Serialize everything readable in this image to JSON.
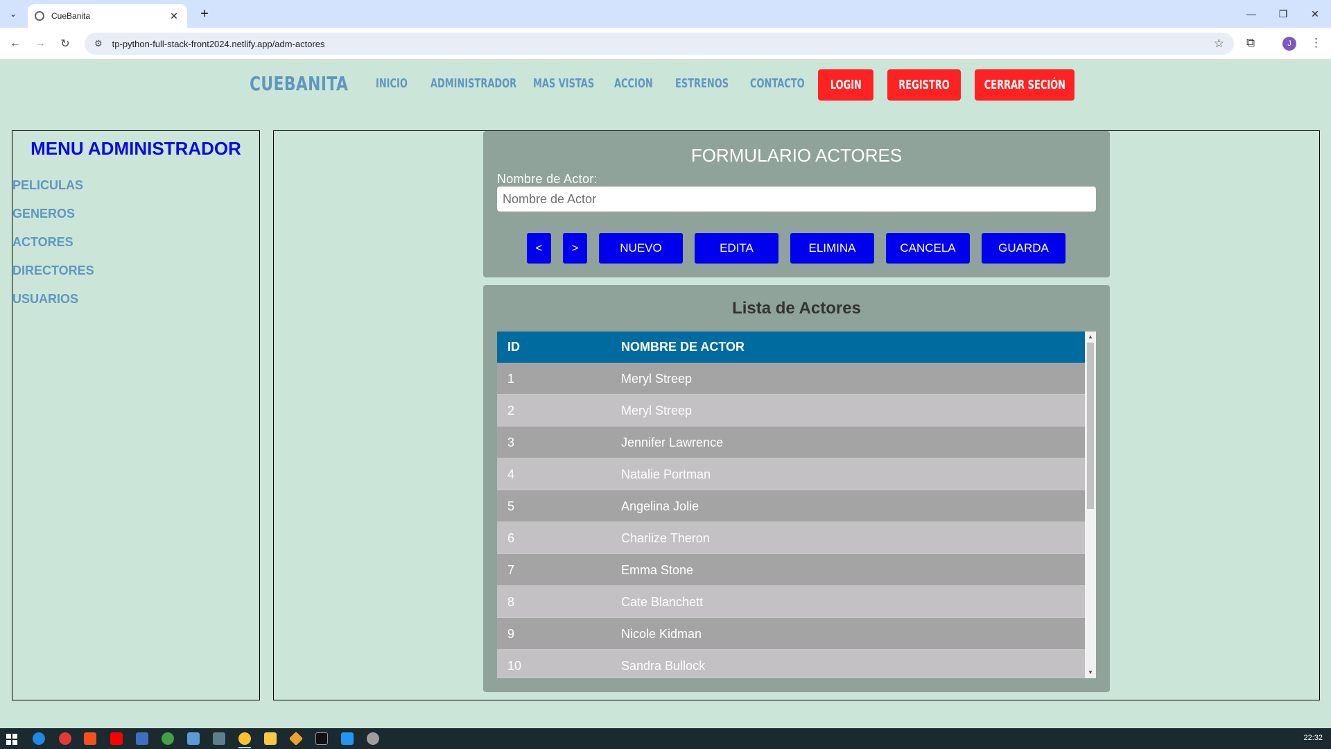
{
  "browser": {
    "tab_title": "CueBanita",
    "new_tab": "+",
    "close_tab": "✕",
    "url": "tp-python-full-stack-front2024.netlify.app/adm-actores",
    "profile_initial": "J"
  },
  "header": {
    "logo": "CUEBANITA",
    "nav": [
      "INICIO",
      "ADMINISTRADOR",
      "MAS VISTAS",
      "ACCION",
      "ESTRENOS",
      "CONTACTO"
    ],
    "login": "LOGIN",
    "registro": "REGISTRO",
    "cerrar": "CERRAR SECIÓN",
    "accent_color": "#ff2222",
    "link_color": "#5f97c0"
  },
  "sidebar": {
    "title": "MENU ADMINISTRADOR",
    "items": [
      "PELICULAS",
      "GENEROS",
      "ACTORES",
      "DIRECTORES",
      "USUARIOS"
    ]
  },
  "form": {
    "title": "FORMULARIO ACTORES",
    "label": "Nombre de Actor:",
    "input_value": "",
    "input_placeholder": "Nombre de Actor",
    "buttons": {
      "prev": "<",
      "next": ">",
      "nuevo": "NUEVO",
      "edita": "EDITA",
      "elimina": "ELIMINA",
      "cancela": "CANCELA",
      "guarda": "GUARDA"
    }
  },
  "list": {
    "title": "Lista de Actores",
    "columns": [
      "ID",
      "NOMBRE DE ACTOR"
    ],
    "rows": [
      {
        "id": "1",
        "name": "Meryl Streep"
      },
      {
        "id": "2",
        "name": "Meryl Streep"
      },
      {
        "id": "3",
        "name": "Jennifer Lawrence"
      },
      {
        "id": "4",
        "name": "Natalie Portman"
      },
      {
        "id": "5",
        "name": "Angelina Jolie"
      },
      {
        "id": "6",
        "name": "Charlize Theron"
      },
      {
        "id": "7",
        "name": "Emma Stone"
      },
      {
        "id": "8",
        "name": "Cate Blanchett"
      },
      {
        "id": "9",
        "name": "Nicole Kidman"
      },
      {
        "id": "10",
        "name": "Sandra Bullock"
      }
    ]
  },
  "taskbar": {
    "clock": "22:32",
    "apps": [
      "edge-icon",
      "chrome-icon",
      "office-icon",
      "youtube-icon",
      "vscode-icon",
      "chrome-alt-icon",
      "remote-icon",
      "calculator-icon",
      "chrome-active-icon",
      "file-explorer-icon",
      "git-icon",
      "terminal-icon",
      "visual-studio-code-icon",
      "paint-icon"
    ]
  }
}
